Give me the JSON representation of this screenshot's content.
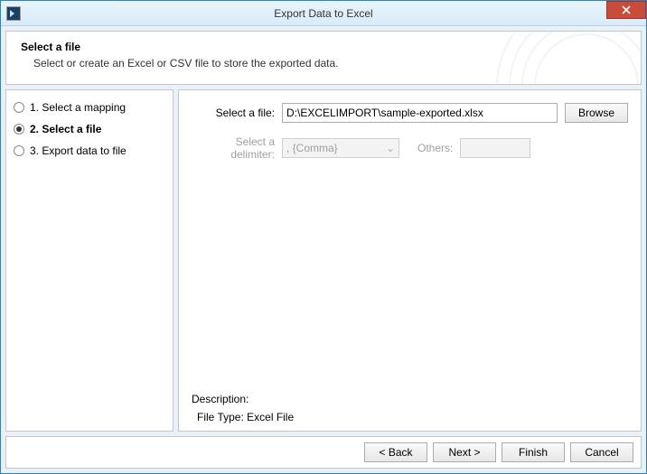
{
  "window": {
    "title": "Export Data to Excel"
  },
  "header": {
    "title": "Select a file",
    "subtitle": "Select or create an Excel or CSV file to store the exported data."
  },
  "sidebar": {
    "steps": [
      {
        "label": "1. Select a mapping",
        "active": false
      },
      {
        "label": "2. Select a file",
        "active": true
      },
      {
        "label": "3. Export data to file",
        "active": false
      }
    ]
  },
  "form": {
    "file_label": "Select a file:",
    "file_value": "D:\\EXCELIMPORT\\sample-exported.xlsx",
    "browse_label": "Browse",
    "delimiter_label": "Select a delimiter:",
    "delimiter_value": ", {Comma}",
    "others_label": "Others:",
    "others_value": ""
  },
  "description": {
    "heading": "Description:",
    "line": "File Type: Excel File"
  },
  "footer": {
    "back": "< Back",
    "next": "Next >",
    "finish": "Finish",
    "cancel": "Cancel"
  }
}
